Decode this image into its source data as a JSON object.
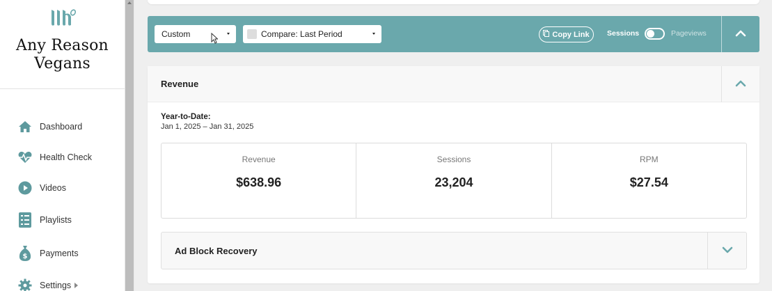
{
  "sidebar": {
    "site_name_line1": "Any Reason",
    "site_name_line2": "Vegans",
    "items": [
      {
        "label": "Dashboard",
        "icon": "home-icon"
      },
      {
        "label": "Health Check",
        "icon": "heart-pulse-icon"
      },
      {
        "label": "Videos",
        "icon": "play-circle-icon"
      },
      {
        "label": "Playlists",
        "icon": "checklist-icon"
      },
      {
        "label": "Payments",
        "icon": "money-bag-icon"
      },
      {
        "label": "Settings",
        "icon": "gear-icon"
      }
    ]
  },
  "filter_bar": {
    "date_select_value": "Custom",
    "compare_select_value": "Compare: Last Period",
    "copy_link_label": "Copy Link",
    "toggle_on_label": "Sessions",
    "toggle_off_label": "Pageviews"
  },
  "revenue_panel": {
    "title": "Revenue",
    "ytd_label": "Year-to-Date:",
    "ytd_range": "Jan 1, 2025 – Jan 31, 2025",
    "stats": [
      {
        "label": "Revenue",
        "value": "$638.96"
      },
      {
        "label": "Sessions",
        "value": "23,204"
      },
      {
        "label": "RPM",
        "value": "$27.54"
      }
    ],
    "ad_block_title": "Ad Block Recovery"
  },
  "colors": {
    "accent": "#6aa8ac",
    "icon_teal": "#5e9a9e"
  }
}
